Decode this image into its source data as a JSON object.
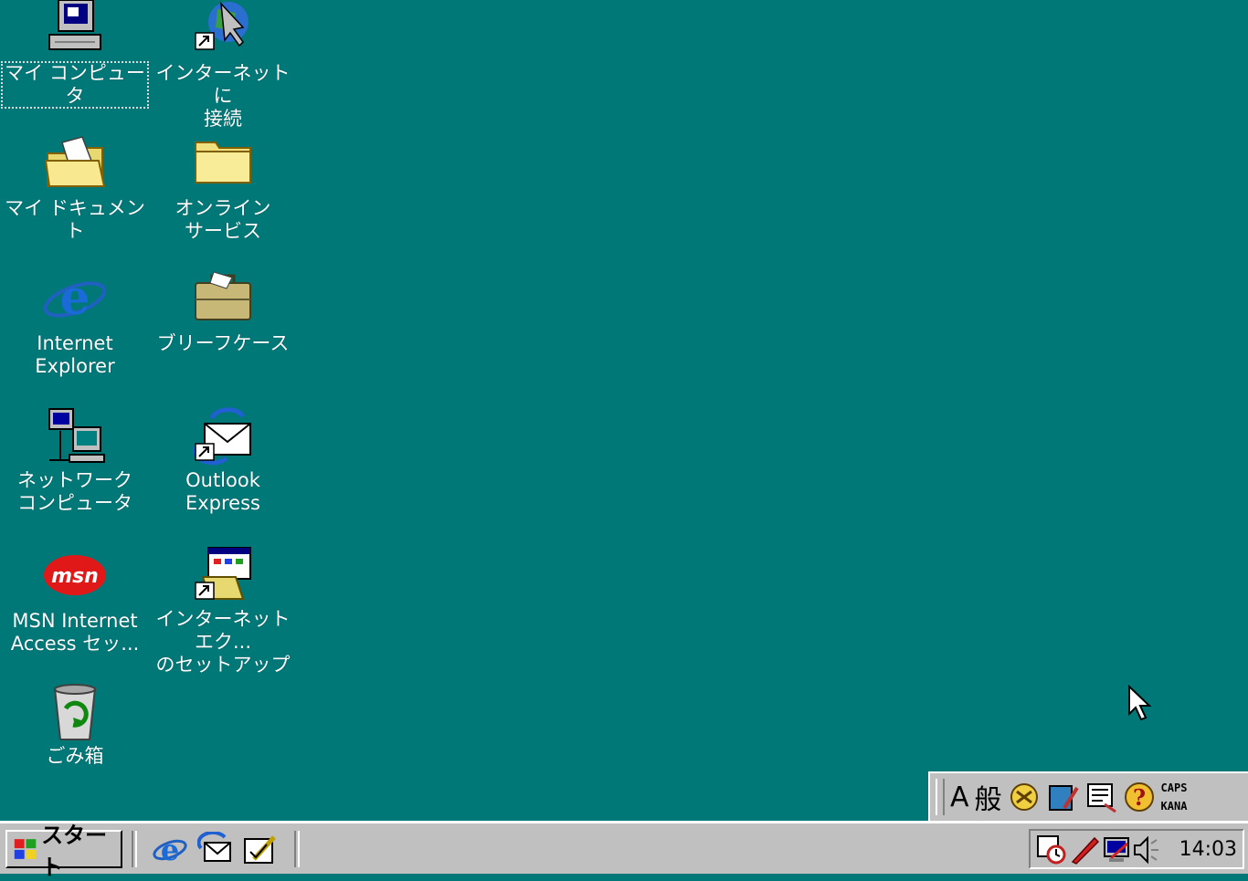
{
  "desktop": {
    "background_color": "#007878",
    "icons": [
      {
        "label": "マイ コンピュータ",
        "icon": "my-computer-icon"
      },
      {
        "label": "インターネットに\n接続",
        "icon": "connect-internet-icon"
      },
      {
        "label": "マイ ドキュメント",
        "icon": "my-documents-icon"
      },
      {
        "label": "オンライン\nサービス",
        "icon": "online-services-folder-icon"
      },
      {
        "label": "Internet\nExplorer",
        "icon": "internet-explorer-icon"
      },
      {
        "label": "ブリーフケース",
        "icon": "briefcase-icon"
      },
      {
        "label": "ネットワーク\nコンピュータ",
        "icon": "network-neighborhood-icon"
      },
      {
        "label": "Outlook\nExpress",
        "icon": "outlook-express-icon"
      },
      {
        "label": "MSN Internet\nAccess セッ...",
        "icon": "msn-icon"
      },
      {
        "label": "インターネットエク...\nのセットアップ",
        "icon": "ie-setup-icon"
      },
      {
        "label": "ごみ箱",
        "icon": "recycle-bin-icon"
      }
    ]
  },
  "ime_bar": {
    "input_mode": "A",
    "conversion_mode": "般",
    "status_top": "CAPS",
    "status_bottom": "KANA"
  },
  "taskbar": {
    "start_label": "スタート",
    "clock": "14:03"
  }
}
